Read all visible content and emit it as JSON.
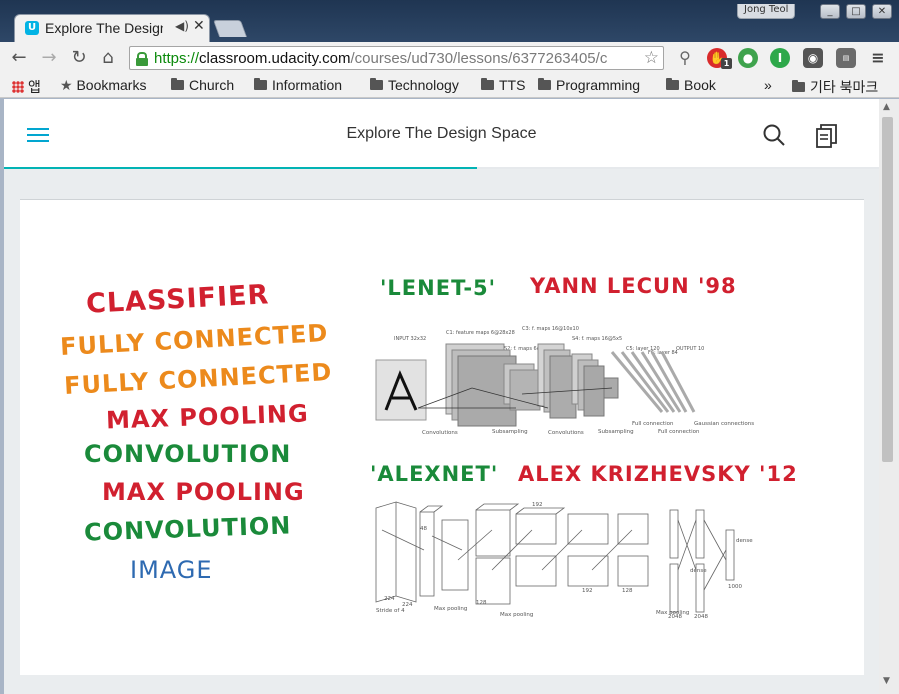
{
  "browser": {
    "tab_title": "Explore The Design Space",
    "profile_name": "Jong Teol",
    "url_scheme": "https://",
    "url_host": "classroom.udacity.com",
    "url_path": "/courses/ud730/lessons/6377263405/c",
    "extension_badge": "1",
    "bookmarks": {
      "apps_label": "앱",
      "bookmarks_label": "Bookmarks",
      "folders": [
        "Church",
        "Information",
        "Technology",
        "TTS",
        "Programming",
        "Book"
      ],
      "overflow": "»",
      "other_bookmarks": "기타 북마크"
    }
  },
  "page": {
    "title": "Explore The Design Space",
    "lesson_progress": 0.54
  },
  "slide": {
    "stack_layers": [
      {
        "text": "CLASSIFIER",
        "color": "#d1202f"
      },
      {
        "text": "FULLY CONNECTED",
        "color": "#ec8a1c"
      },
      {
        "text": "FULLY CONNECTED",
        "color": "#ec8a1c"
      },
      {
        "text": "MAX POOLING",
        "color": "#d1202f"
      },
      {
        "text": "CONVOLUTION",
        "color": "#1a8a3a"
      },
      {
        "text": "MAX POOLING",
        "color": "#d1202f"
      },
      {
        "text": "CONVOLUTION",
        "color": "#1a8a3a"
      },
      {
        "text": "IMAGE",
        "color": "#2e6ab1"
      }
    ],
    "lenet_caption": {
      "name": "'LENET-5'",
      "author": "YANN LECUN '98"
    },
    "lenet_labels": {
      "input": "INPUT 32x32",
      "c1": "C1: feature maps 6@28x28",
      "s2": "S2: f. maps 6@14x14",
      "c3": "C3: f. maps 16@10x10",
      "s4": "S4: f. maps 16@5x5",
      "c5": "C5: layer 120",
      "f6": "F6: layer 84",
      "output": "OUTPUT 10",
      "bottom": [
        "Convolutions",
        "Subsampling",
        "Convolutions",
        "Subsampling",
        "Full connection",
        "Full connection",
        "Gaussian connections"
      ]
    },
    "alexnet_caption": {
      "name": "'ALEXNET'",
      "author": "ALEX KRIZHEVSKY '12"
    },
    "alexnet_labels": {
      "stride": "Stride of 4",
      "maxpool": "Max pooling",
      "dense": "dense",
      "sizes": [
        "224",
        "224",
        "48",
        "128",
        "192",
        "192",
        "128",
        "2048",
        "2048",
        "1000"
      ]
    }
  }
}
